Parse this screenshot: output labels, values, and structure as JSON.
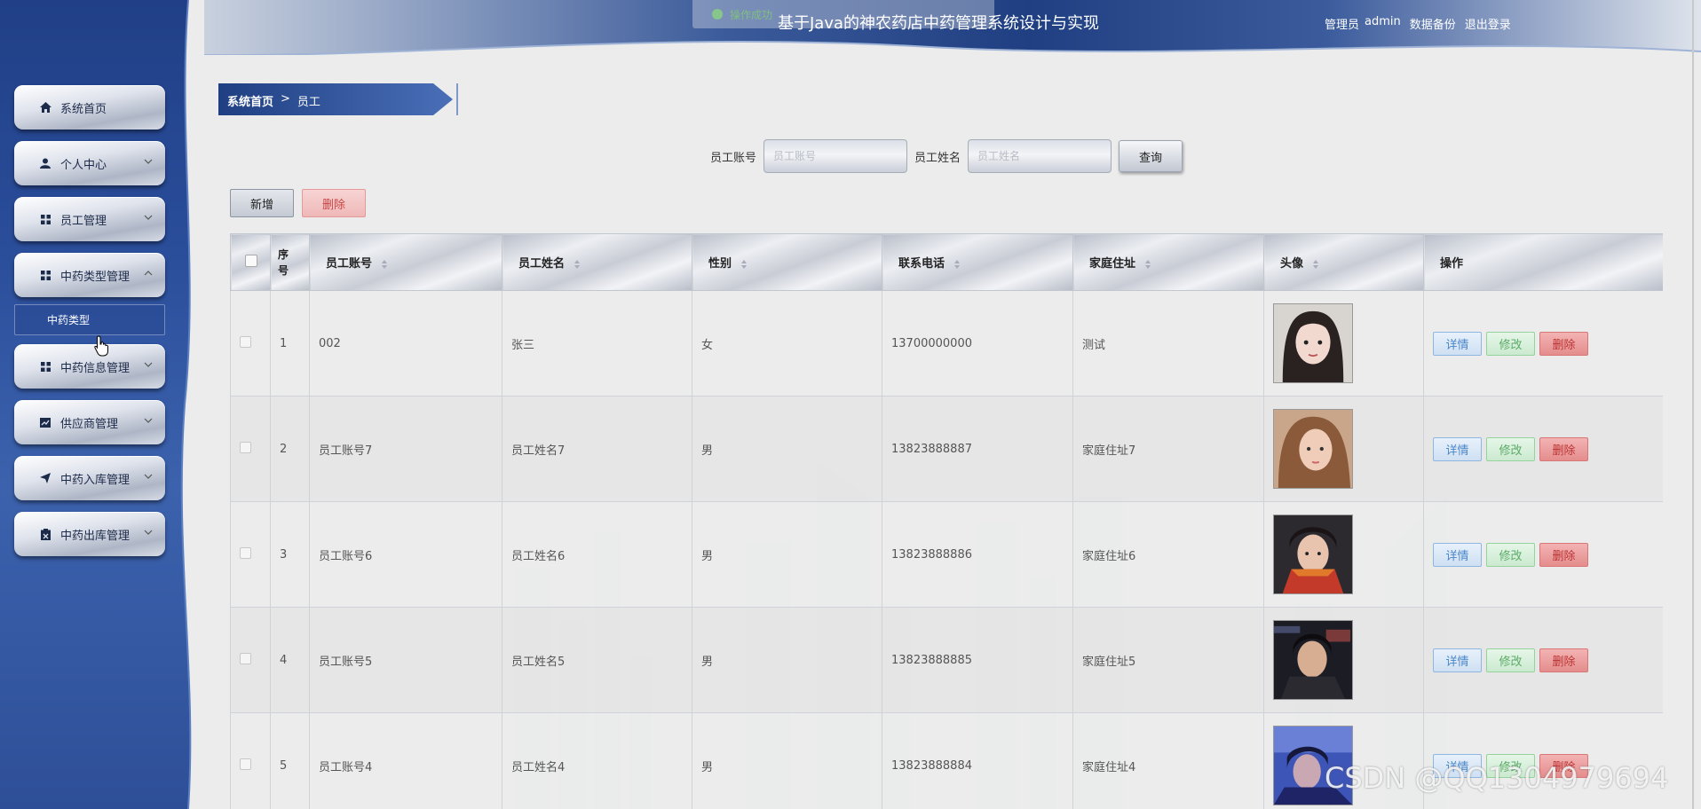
{
  "header": {
    "title": "基于Java的神农药店中药管理系统设计与实现",
    "toast": "操作成功",
    "user_role": "管理员",
    "username": "admin",
    "backup_label": "数据备份",
    "logout_label": "退出登录"
  },
  "sidebar": {
    "items": [
      {
        "label": "系统首页",
        "icon": "home-icon"
      },
      {
        "label": "个人中心",
        "icon": "user-icon"
      },
      {
        "label": "员工管理",
        "icon": "grid-icon"
      },
      {
        "label": "中药类型管理",
        "icon": "grid-icon"
      },
      {
        "label": "中药信息管理",
        "icon": "grid-icon"
      },
      {
        "label": "供应商管理",
        "icon": "chart-icon"
      },
      {
        "label": "中药入库管理",
        "icon": "send-icon"
      },
      {
        "label": "中药出库管理",
        "icon": "clipboard-icon"
      }
    ],
    "submenu": {
      "label": "中药类型"
    }
  },
  "breadcrumb": {
    "home": "系统首页",
    "separator": ">",
    "current": "员工"
  },
  "search": {
    "account_label": "员工账号",
    "account_placeholder": "员工账号",
    "name_label": "员工姓名",
    "name_placeholder": "员工姓名",
    "query_label": "查询"
  },
  "actions": {
    "add_label": "新增",
    "delete_label": "删除"
  },
  "table": {
    "headers": {
      "index": "序号",
      "account": "员工账号",
      "name": "员工姓名",
      "gender": "性别",
      "phone": "联系电话",
      "address": "家庭住址",
      "avatar": "头像",
      "ops": "操作"
    },
    "rows": [
      {
        "index": "1",
        "account": "002",
        "name": "张三",
        "gender": "女",
        "phone": "13700000000",
        "address": "测试"
      },
      {
        "index": "2",
        "account": "员工账号7",
        "name": "员工姓名7",
        "gender": "男",
        "phone": "13823888887",
        "address": "家庭住址7"
      },
      {
        "index": "3",
        "account": "员工账号6",
        "name": "员工姓名6",
        "gender": "男",
        "phone": "13823888886",
        "address": "家庭住址6"
      },
      {
        "index": "4",
        "account": "员工账号5",
        "name": "员工姓名5",
        "gender": "男",
        "phone": "13823888885",
        "address": "家庭住址5"
      },
      {
        "index": "5",
        "account": "员工账号4",
        "name": "员工姓名4",
        "gender": "男",
        "phone": "13823888884",
        "address": "家庭住址4"
      }
    ],
    "row_actions": {
      "detail": "详情",
      "edit": "修改",
      "delete": "删除"
    }
  },
  "watermark": "CSDN @QQ1304979694",
  "colors": {
    "sidebar": "#2a4d9a",
    "detail": "#4a86c8",
    "edit": "#5bab66",
    "delete": "#c44"
  }
}
